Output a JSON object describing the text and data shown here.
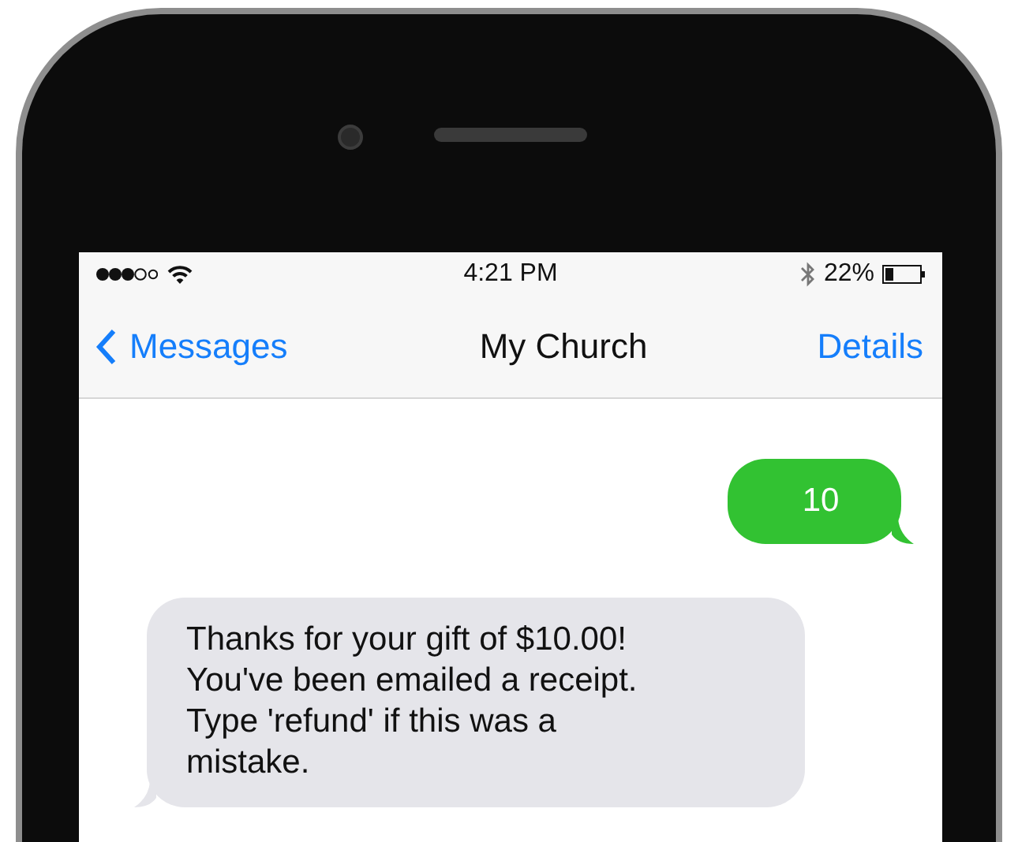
{
  "status_bar": {
    "time": "4:21 PM",
    "battery": "22%"
  },
  "nav": {
    "back": "Messages",
    "title": "My Church",
    "action": "Details"
  },
  "messages": [
    {
      "kind": "sent",
      "text": "10"
    },
    {
      "kind": "received",
      "text": "Thanks for your gift of $10.00! You've been emailed a receipt. Type 'refund' if this was a mistake."
    }
  ]
}
